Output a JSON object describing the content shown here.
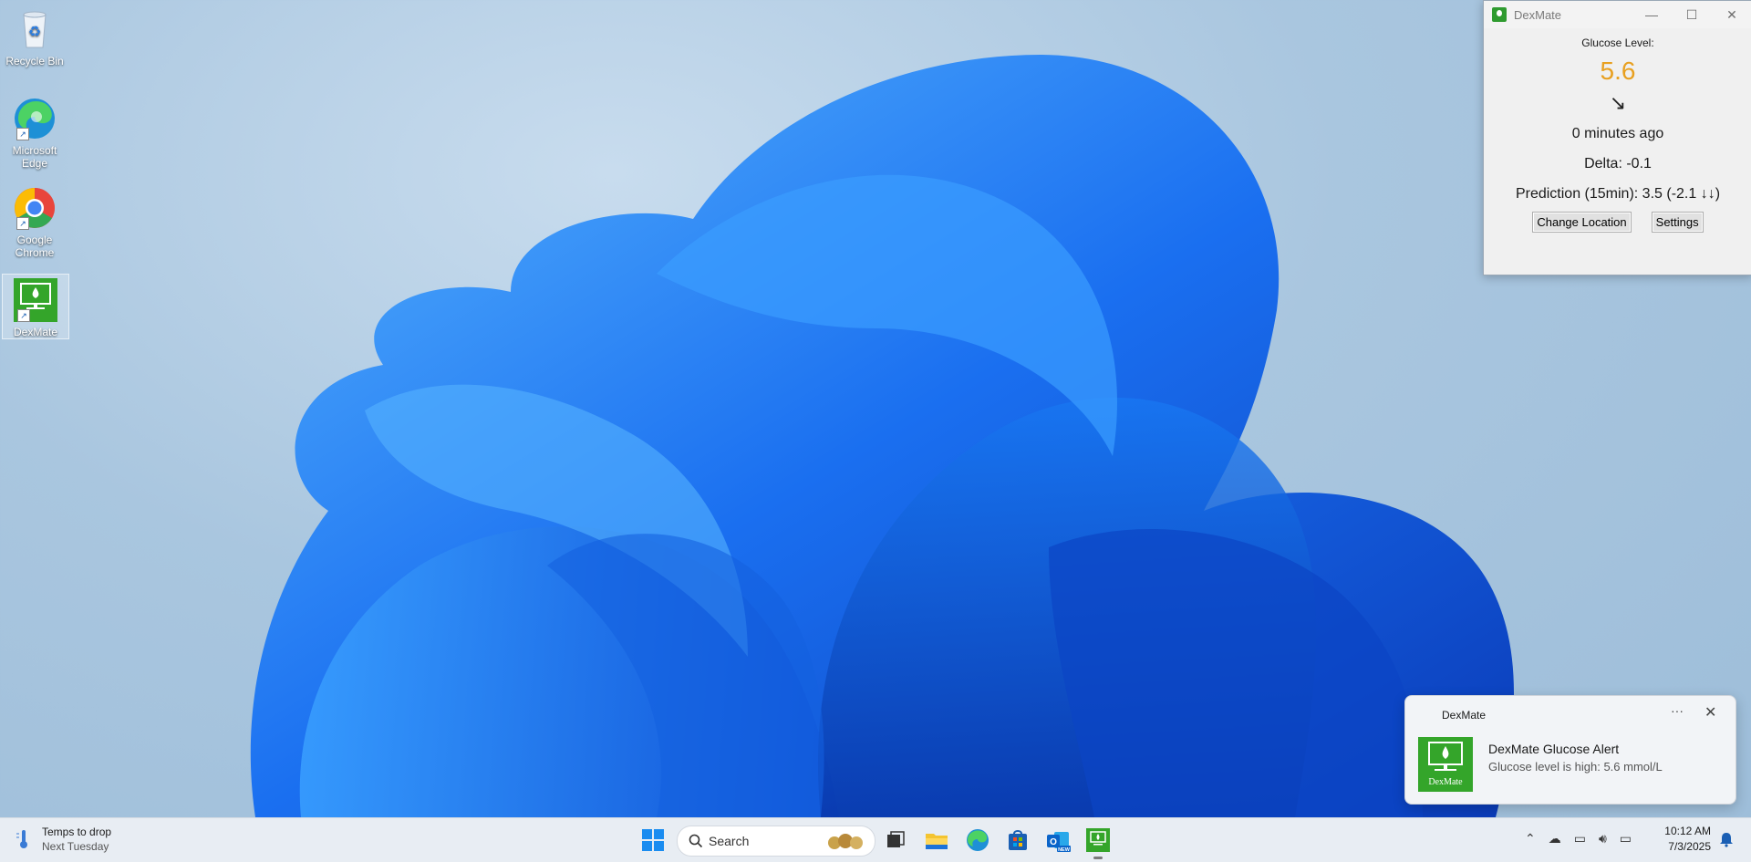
{
  "desktop": {
    "icons": [
      {
        "label": "Recycle Bin"
      },
      {
        "label": "Microsoft Edge"
      },
      {
        "label": "Google Chrome"
      },
      {
        "label": "DexMate"
      }
    ]
  },
  "dexmate_window": {
    "title": "DexMate",
    "glucose_label": "Glucose Level:",
    "glucose_value": "5.6",
    "glucose_color": "#e8a020",
    "trend_arrow": "↘",
    "last_update": "0 minutes ago",
    "delta": "Delta: -0.1",
    "prediction": "Prediction (15min): 3.5 (-2.1 ↓↓)",
    "buttons": {
      "change_location": "Change Location",
      "settings": "Settings"
    },
    "controls": {
      "minimize": "—",
      "maximize": "☐",
      "close": "✕"
    }
  },
  "toast": {
    "app_name": "DexMate",
    "more": "···",
    "close": "✕",
    "title": "DexMate Glucose Alert",
    "message": "Glucose level is high: 5.6 mmol/L",
    "logo_text": "DexMate"
  },
  "taskbar": {
    "weather_title": "Temps to drop",
    "weather_subtitle": "Next Tuesday",
    "search_placeholder": "Search",
    "time": "10:12 AM",
    "date": "7/3/2025",
    "outlook_badge": "NEW"
  }
}
